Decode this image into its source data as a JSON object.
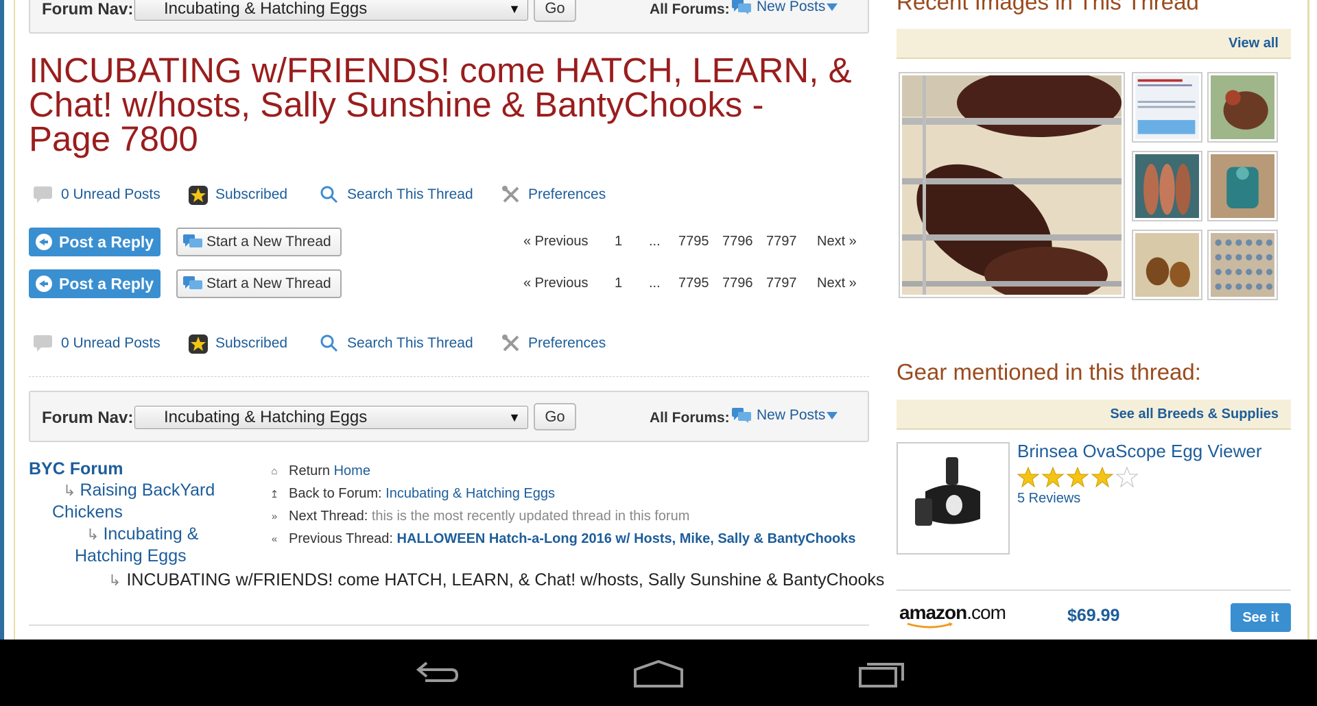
{
  "forum_nav": {
    "label": "Forum Nav:",
    "selected": "Incubating & Hatching Eggs",
    "go": "Go",
    "all_forums": "All Forums:",
    "new_posts": "New Posts"
  },
  "thread": {
    "title": "INCUBATING w/FRIENDS! come HATCH, LEARN, & Chat! w/hosts, Sally Sunshine & BantyChooks - Page 7800"
  },
  "tools": {
    "unread": "0 Unread Posts",
    "subscribed": "Subscribed",
    "search": "Search This Thread",
    "preferences": "Preferences"
  },
  "actions": {
    "post_reply": "Post a Reply",
    "new_thread": "Start a New Thread"
  },
  "pager": {
    "previous": "« Previous",
    "first": "1",
    "ellipsis": "...",
    "pages": [
      "7795",
      "7796",
      "7797"
    ],
    "next": "Next »"
  },
  "breadcrumb": {
    "root": "BYC Forum",
    "level1": "Raising BackYard Chickens",
    "level1_a": "Raising BackYard",
    "level1_b": "Chickens",
    "level2_a": "Incubating &",
    "level2_b": "Hatching Eggs",
    "current": "INCUBATING w/FRIENDS! come HATCH, LEARN, & Chat! w/hosts, Sally Sunshine & BantyChooks"
  },
  "links": {
    "return_prefix": "Return",
    "return_link": "Home",
    "back_prefix": "Back to Forum:",
    "back_link": "Incubating & Hatching Eggs",
    "next_prefix": "Next Thread:",
    "next_text": "this is the most recently updated thread in this forum",
    "prev_prefix": "Previous Thread:",
    "prev_link": "HALLOWEEN Hatch-a-Long 2016 w/ Hosts, Mike, Sally & BantyChooks"
  },
  "sidebar": {
    "recent_images_title": "Recent Images in This Thread",
    "view_all": "View all",
    "gear_title": "Gear mentioned in this thread:",
    "see_all": "See all Breeds & Supplies",
    "product": {
      "name": "Brinsea OvaScope Egg Viewer",
      "rating": 4,
      "max_rating": 5,
      "reviews": "5 Reviews",
      "store": "amazon",
      "store_suffix": ".com",
      "price": "$69.99",
      "cta": "See it"
    }
  },
  "colors": {
    "title_red": "#9a1d1d",
    "link_blue": "#1d5d9b",
    "button_blue": "#3a8fd1",
    "sidebar_heading": "#9a4b1d"
  }
}
